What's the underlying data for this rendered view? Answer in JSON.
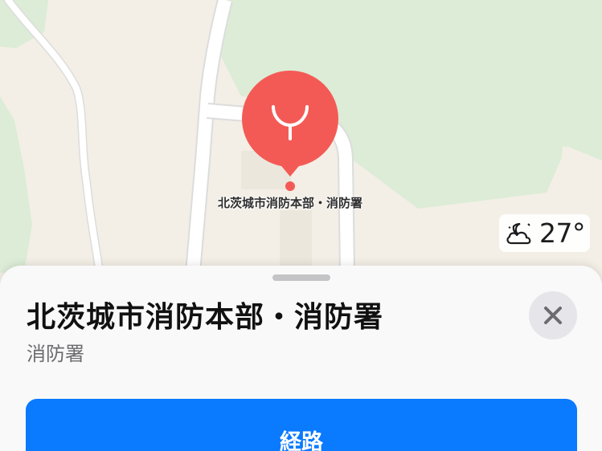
{
  "map": {
    "place_label": "北茨城市消防本部・消防署",
    "pin_icon": "fire-station-icon",
    "pin_color": "#f45a55"
  },
  "weather": {
    "icon": "partly-cloudy-night-icon",
    "temperature": "27°"
  },
  "sheet": {
    "title": "北茨城市消防本部・消防署",
    "subtitle": "消防署",
    "close_icon": "close-icon",
    "route_label": "経路"
  },
  "colors": {
    "map_land": "#f3efe6",
    "map_green": "#dcecd6",
    "route_button": "#0a7aff",
    "close_button_bg": "#e5e5ea"
  }
}
